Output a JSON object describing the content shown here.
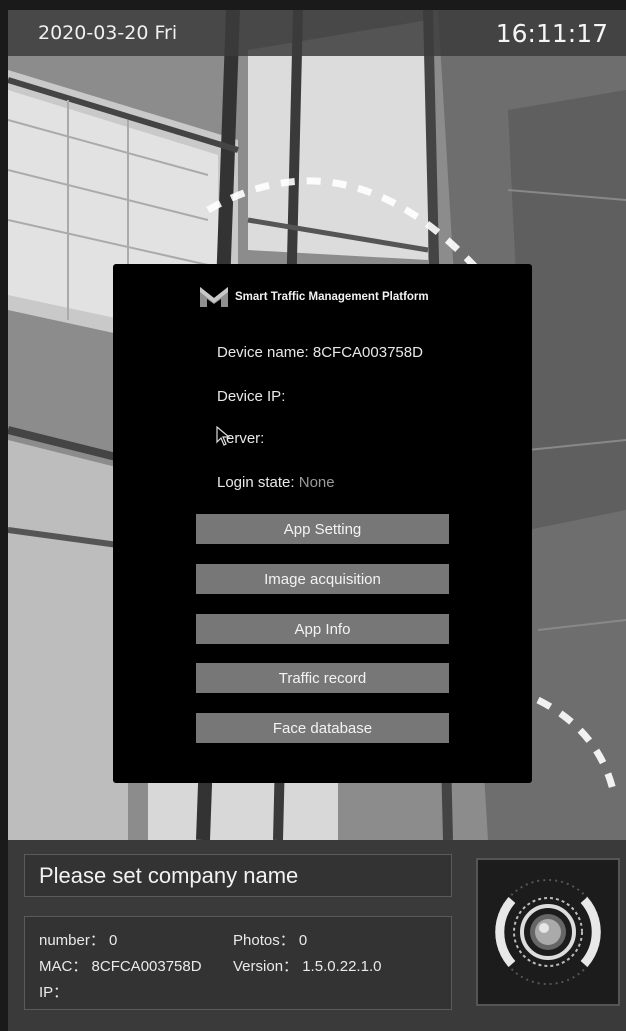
{
  "status_bar": {
    "date": "2020-03-20 Fri",
    "time": "16:11:17"
  },
  "dialog": {
    "title": "Smart Traffic Management Platform",
    "logo_icon": "m-logo-icon",
    "device_name_label": "Device name: ",
    "device_name_value": "8CFCA003758D",
    "device_ip_label": "Device IP:",
    "server_label": "erver:",
    "login_state_label": "Login state: ",
    "login_state_value": "None",
    "buttons": [
      "App Setting",
      "Image acquisition",
      "App Info",
      "Traffic record",
      "Face database"
    ]
  },
  "bottom": {
    "company_name": "Please set company name",
    "number_label": "number：",
    "number_value": "0",
    "photos_label": "Photos：",
    "photos_value": "0",
    "mac_label": "MAC：",
    "mac_value": "8CFCA003758D",
    "version_label": "Version：",
    "version_value": "1.5.0.22.1.0",
    "ip_label": "IP："
  },
  "colors": {
    "dialog_bg": "#000000",
    "button_bg": "#777777",
    "login_value": "#9a9a9a"
  }
}
